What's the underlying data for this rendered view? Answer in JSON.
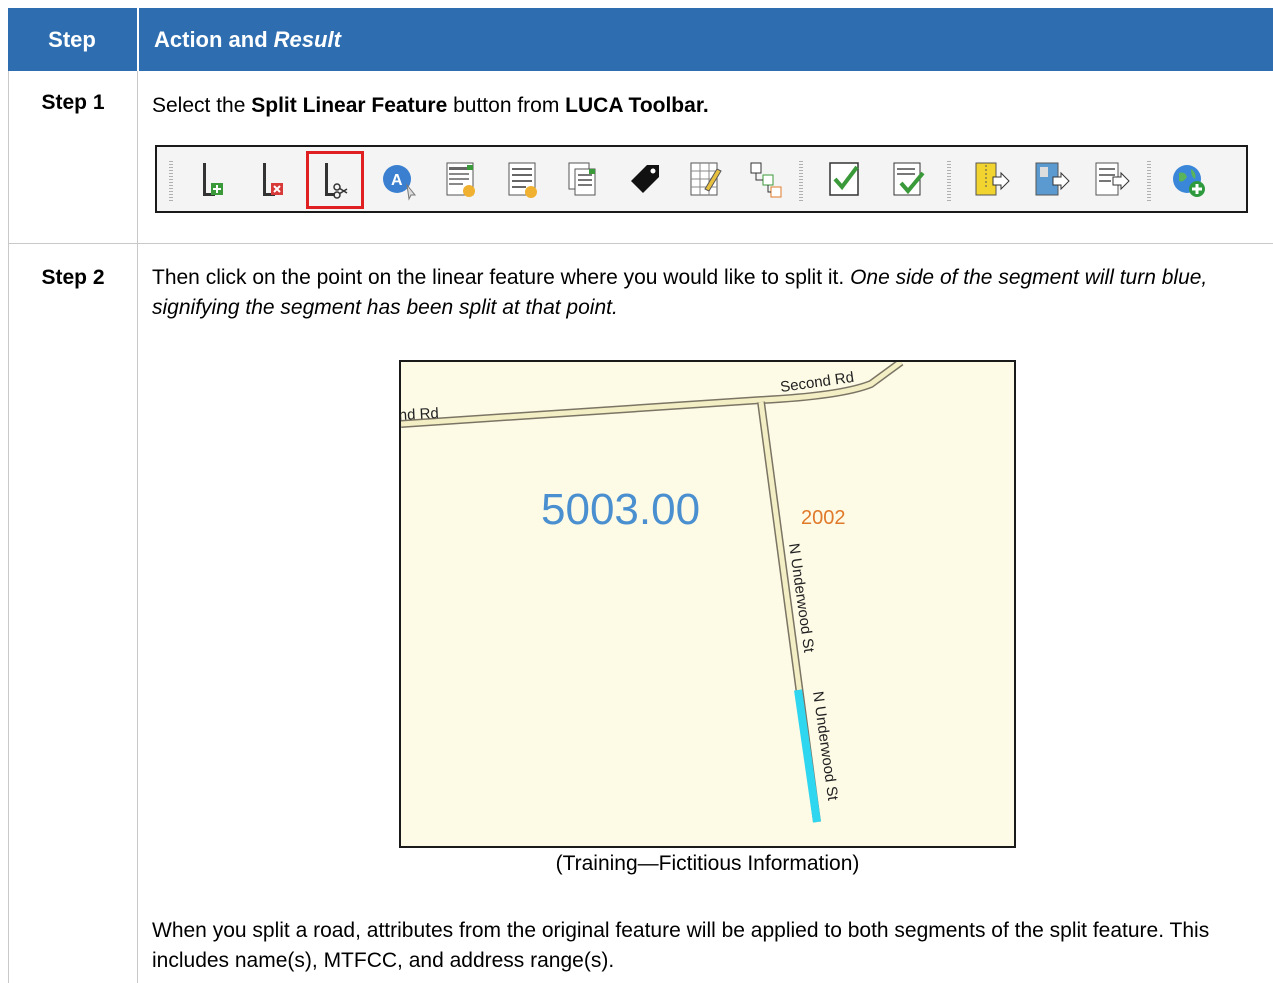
{
  "header": {
    "step": "Step",
    "action": "Action and",
    "result": "Result"
  },
  "step1": {
    "label": "Step 1",
    "text": {
      "pre": "Select the ",
      "b1": "Split Linear Feature",
      "mid": " button from ",
      "b2": "LUCA Toolbar."
    },
    "toolbar_icons": [
      "add-linear-feature-icon",
      "delete-linear-feature-icon",
      "split-linear-feature-icon",
      "address-icon",
      "attribute-table-add-icon",
      "list-add-icon",
      "copy-records-icon",
      "tag-icon",
      "edit-table-icon",
      "hierarchy-icon",
      "check-icon",
      "review-check-icon",
      "zip-export-icon",
      "map-export-icon",
      "list-export-icon",
      "globe-add-icon"
    ]
  },
  "step2": {
    "label": "Step 2",
    "text1": "Then click on the point on the linear feature where you would like to split it. ",
    "text1_italic": "One side of the segment will turn blue, signifying the segment has been split at that point.",
    "map": {
      "road_top_right": "Second Rd",
      "road_top_left": "nd Rd",
      "tract_label": "5003.00",
      "block_label": "2002",
      "street_upper": "N Underwood St",
      "street_lower": "N Underwood St",
      "colors": {
        "background": "#fdfae6",
        "tract": "#4a8fcf",
        "block": "#e07a2a",
        "split": "#2fd6f0"
      }
    },
    "caption": "(Training—Fictitious Information)",
    "note": "When you split a road, attributes from the original feature will be applied to both segments of the split feature. This includes name(s), MTFCC, and address range(s)."
  }
}
